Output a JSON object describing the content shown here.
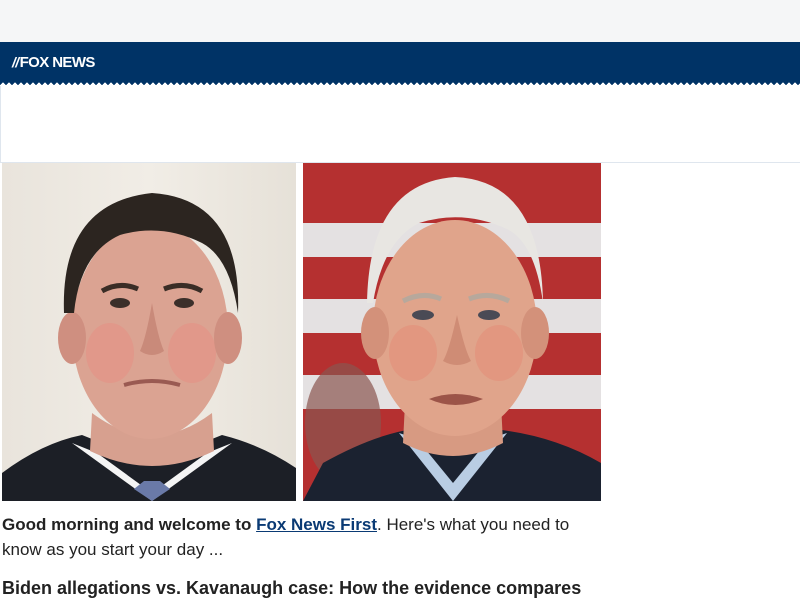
{
  "header": {
    "logo_text": "FOX NEWS",
    "logo_mark": "//",
    "brand_color": "#003366"
  },
  "photos": [
    {
      "subject": "brett-kavanaugh"
    },
    {
      "subject": "joe-biden"
    }
  ],
  "intro": {
    "greeting": "Good morning and welcome to",
    "link_text": "Fox News First",
    "after_link": ". Here's what you need to know as you start your day ..."
  },
  "headline": {
    "text": "Biden allegations vs. Kavanaugh case: How the evidence compares"
  },
  "colors": {
    "link": "#0a3a74",
    "text": "#222222"
  }
}
